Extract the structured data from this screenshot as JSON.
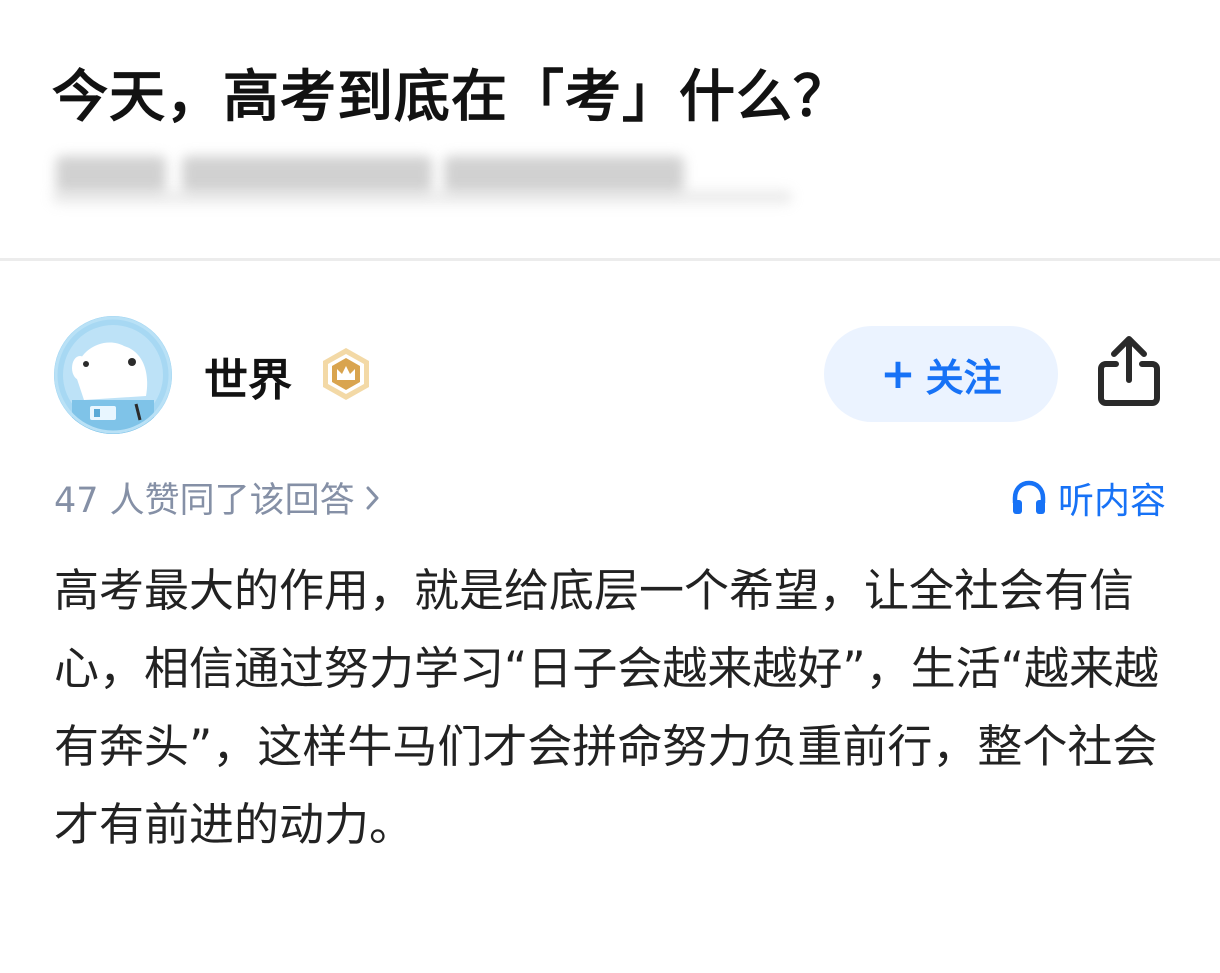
{
  "question": {
    "title": "今天，高考到底在「考」什么？"
  },
  "author": {
    "name": "世界",
    "badge_icon": "crown-badge-icon",
    "avatar_icon": "cartoon-dog-astronaut-avatar"
  },
  "actions": {
    "follow_plus": "+",
    "follow_label": "关注",
    "share_icon": "share-icon"
  },
  "meta": {
    "upvote_text": "47 人赞同了该回答",
    "listen_label": "听内容"
  },
  "answer": {
    "text": "高考最大的作用，就是给底层一个希望，让全社会有信心，相信通过努力学习“日子会越来越好”，生活“越来越有奔头”，这样牛马们才会拼命努力负重前行，整个社会才有前进的动力。"
  },
  "colors": {
    "accent": "#1772f6",
    "follow_bg": "#ebf3ff",
    "muted_text": "#8590a6",
    "badge_gold": "#d9a44e"
  }
}
